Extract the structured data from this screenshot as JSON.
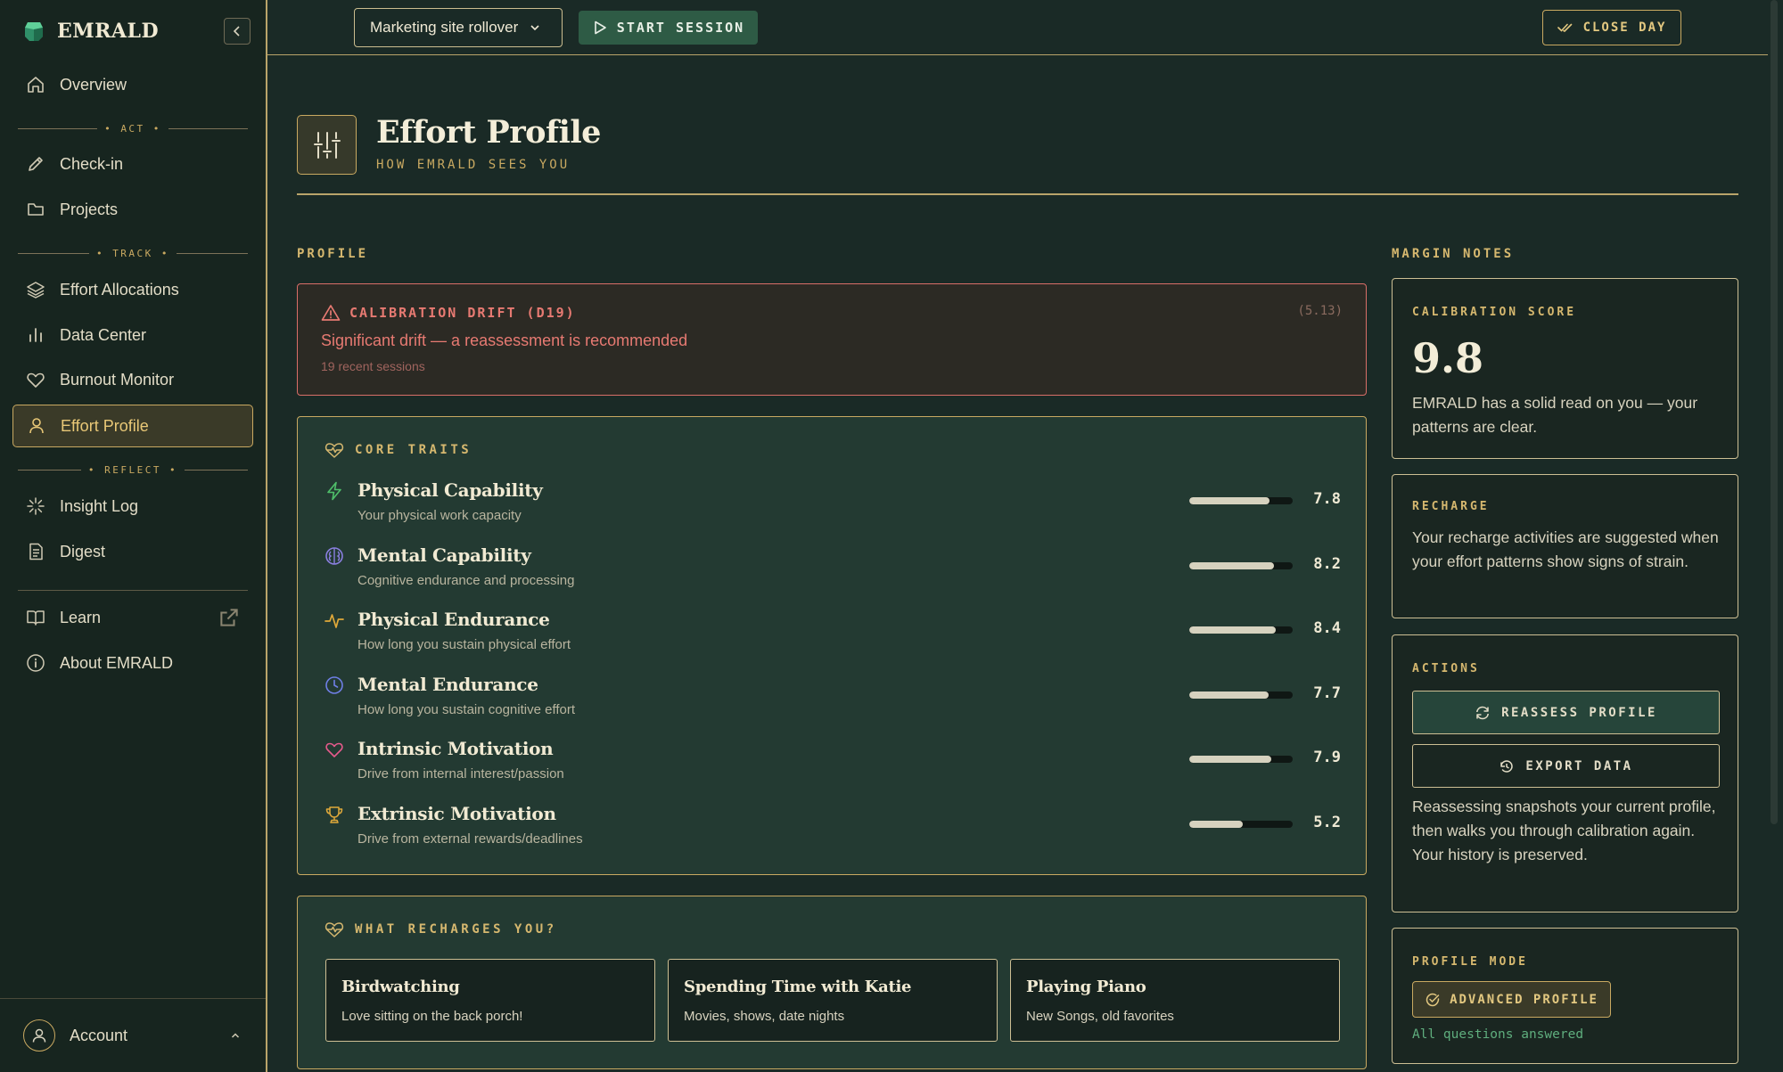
{
  "app": {
    "name": "EMRALD",
    "colors": {
      "accent": "#c9a961",
      "background": "#1a2a26",
      "alert": "#e77a72",
      "success": "#5fae7e"
    }
  },
  "sidebar": {
    "collapse_icon": "chevron-left-icon",
    "sections": [
      {
        "label": "ACT"
      },
      {
        "label": "TRACK"
      },
      {
        "label": "REFLECT"
      }
    ],
    "items": [
      {
        "label": "Overview",
        "icon": "home-icon"
      },
      {
        "label": "Check-in",
        "icon": "pencil-icon"
      },
      {
        "label": "Projects",
        "icon": "folder-icon"
      },
      {
        "label": "Effort Allocations",
        "icon": "layers-icon"
      },
      {
        "label": "Data Center",
        "icon": "bar-chart-icon"
      },
      {
        "label": "Burnout Monitor",
        "icon": "heart-icon"
      },
      {
        "label": "Effort Profile",
        "icon": "user-icon",
        "active": true
      },
      {
        "label": "Insight Log",
        "icon": "sparkle-icon"
      },
      {
        "label": "Digest",
        "icon": "document-icon"
      },
      {
        "label": "Learn",
        "icon": "book-icon",
        "external": true
      },
      {
        "label": "About EMRALD",
        "icon": "info-icon"
      }
    ],
    "account": {
      "label": "Account",
      "icon": "user-circle-icon"
    }
  },
  "topbar": {
    "project_select": {
      "value": "Marketing site rollover"
    },
    "start_session": "START SESSION",
    "close_day": "CLOSE DAY"
  },
  "page": {
    "title": "Effort Profile",
    "subtitle": "HOW EMRALD SEES YOU",
    "icon": "sliders-icon"
  },
  "profile": {
    "section_label": "PROFILE",
    "alert": {
      "title": "CALIBRATION DRIFT (D19)",
      "value": "(5.13)",
      "message": "Significant drift — a reassessment is recommended",
      "sub": "19 recent sessions"
    },
    "core_traits": {
      "heading": "CORE TRAITS",
      "traits": [
        {
          "name": "Physical Capability",
          "desc": "Your physical work capacity",
          "value": "7.8",
          "level": 0.78,
          "icon": "bolt-icon",
          "color": "#4fbf6a"
        },
        {
          "name": "Mental Capability",
          "desc": "Cognitive endurance and processing",
          "value": "8.2",
          "level": 0.82,
          "icon": "brain-icon",
          "color": "#8a7fe0"
        },
        {
          "name": "Physical Endurance",
          "desc": "How long you sustain physical effort",
          "value": "8.4",
          "level": 0.84,
          "icon": "activity-icon",
          "color": "#e0a93a"
        },
        {
          "name": "Mental Endurance",
          "desc": "How long you sustain cognitive effort",
          "value": "7.7",
          "level": 0.77,
          "icon": "clock-icon",
          "color": "#6f7fe6"
        },
        {
          "name": "Intrinsic Motivation",
          "desc": "Drive from internal interest/passion",
          "value": "7.9",
          "level": 0.79,
          "icon": "heart-icon",
          "color": "#e65a8c"
        },
        {
          "name": "Extrinsic Motivation",
          "desc": "Drive from external rewards/deadlines",
          "value": "5.2",
          "level": 0.52,
          "icon": "trophy-icon",
          "color": "#e0a93a"
        }
      ]
    },
    "recharge": {
      "heading": "WHAT RECHARGES YOU?",
      "items": [
        {
          "name": "Birdwatching",
          "desc": "Love sitting on the back porch!"
        },
        {
          "name": "Spending Time with Katie",
          "desc": "Movies, shows, date nights"
        },
        {
          "name": "Playing Piano",
          "desc": "New Songs, old favorites"
        }
      ]
    }
  },
  "margin_notes": {
    "section_label": "MARGIN NOTES",
    "calibration": {
      "label": "CALIBRATION SCORE",
      "score": "9.8",
      "text": "EMRALD has a solid read on you — your patterns are clear."
    },
    "recharge": {
      "label": "RECHARGE",
      "text": "Your recharge activities are suggested when your effort patterns show signs of strain."
    },
    "actions": {
      "label": "ACTIONS",
      "reassess": "REASSESS PROFILE",
      "export": "EXPORT DATA",
      "text": "Reassessing snapshots your current profile, then walks you through calibration again. Your history is preserved."
    },
    "profile_mode": {
      "label": "PROFILE MODE",
      "button": "ADVANCED PROFILE",
      "status": "All questions answered"
    }
  }
}
